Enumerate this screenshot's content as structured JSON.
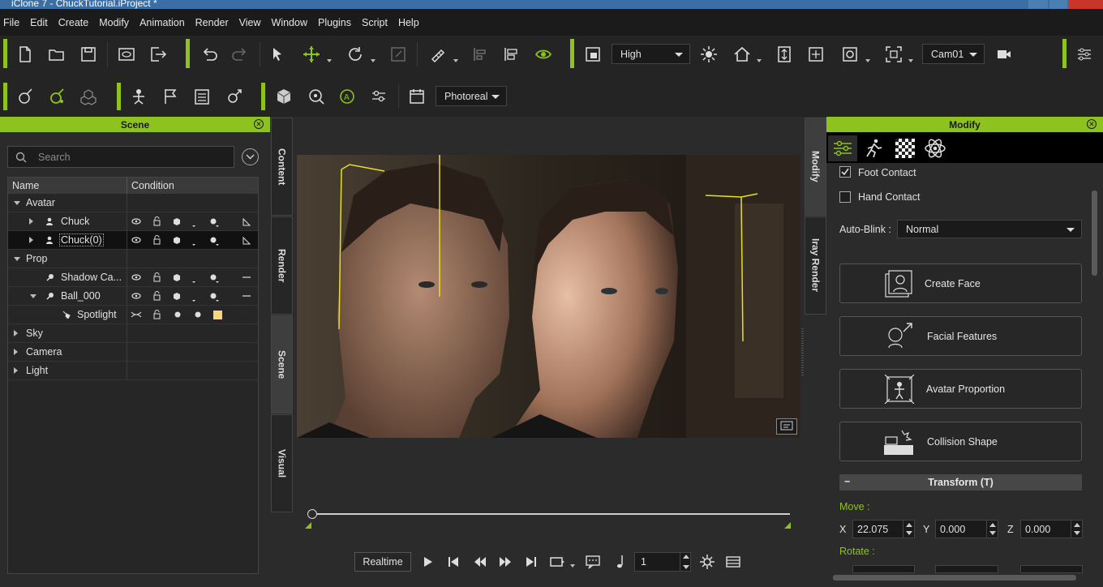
{
  "window": {
    "title": "iClone 7 - ChuckTutorial.iProject *"
  },
  "menu": [
    "File",
    "Edit",
    "Create",
    "Modify",
    "Animation",
    "Render",
    "View",
    "Window",
    "Plugins",
    "Script",
    "Help"
  ],
  "toolbar": {
    "quality": "High",
    "camera": "Cam01",
    "render_mode": "Photoreal"
  },
  "colors": {
    "accent": "#8dc21f",
    "panel_bg": "#2b2b2b",
    "toolbar_bg": "#242424"
  },
  "scene_panel": {
    "title": "Scene",
    "search_placeholder": "Search",
    "col_name": "Name",
    "col_condition": "Condition",
    "rows": [
      {
        "label": "Avatar"
      },
      {
        "label": "Chuck"
      },
      {
        "label": "Chuck(0)"
      },
      {
        "label": "Prop"
      },
      {
        "label": "Shadow Ca..."
      },
      {
        "label": "Ball_000"
      },
      {
        "label": "Spotlight"
      },
      {
        "label": "Sky"
      },
      {
        "label": "Camera"
      },
      {
        "label": "Light"
      }
    ]
  },
  "side_tabs": [
    "Content",
    "Render",
    "Scene",
    "Visual"
  ],
  "right_tabs": [
    "Modify",
    "Iray Render"
  ],
  "timeline": {
    "mode_button": "Realtime",
    "frame": "1"
  },
  "modify_panel": {
    "title": "Modify",
    "foot_contact": "Foot Contact",
    "hand_contact": "Hand Contact",
    "auto_blink_label": "Auto-Blink :",
    "auto_blink_value": "Normal",
    "buttons": [
      "Create Face",
      "Facial Features",
      "Avatar Proportion",
      "Collision Shape"
    ],
    "transform_title": "Transform  (T)",
    "move_label": "Move :",
    "rotate_label": "Rotate :",
    "x_label": "X",
    "y_label": "Y",
    "z_label": "Z",
    "move_x": "22.075",
    "move_y": "0.000",
    "move_z": "0.000"
  }
}
